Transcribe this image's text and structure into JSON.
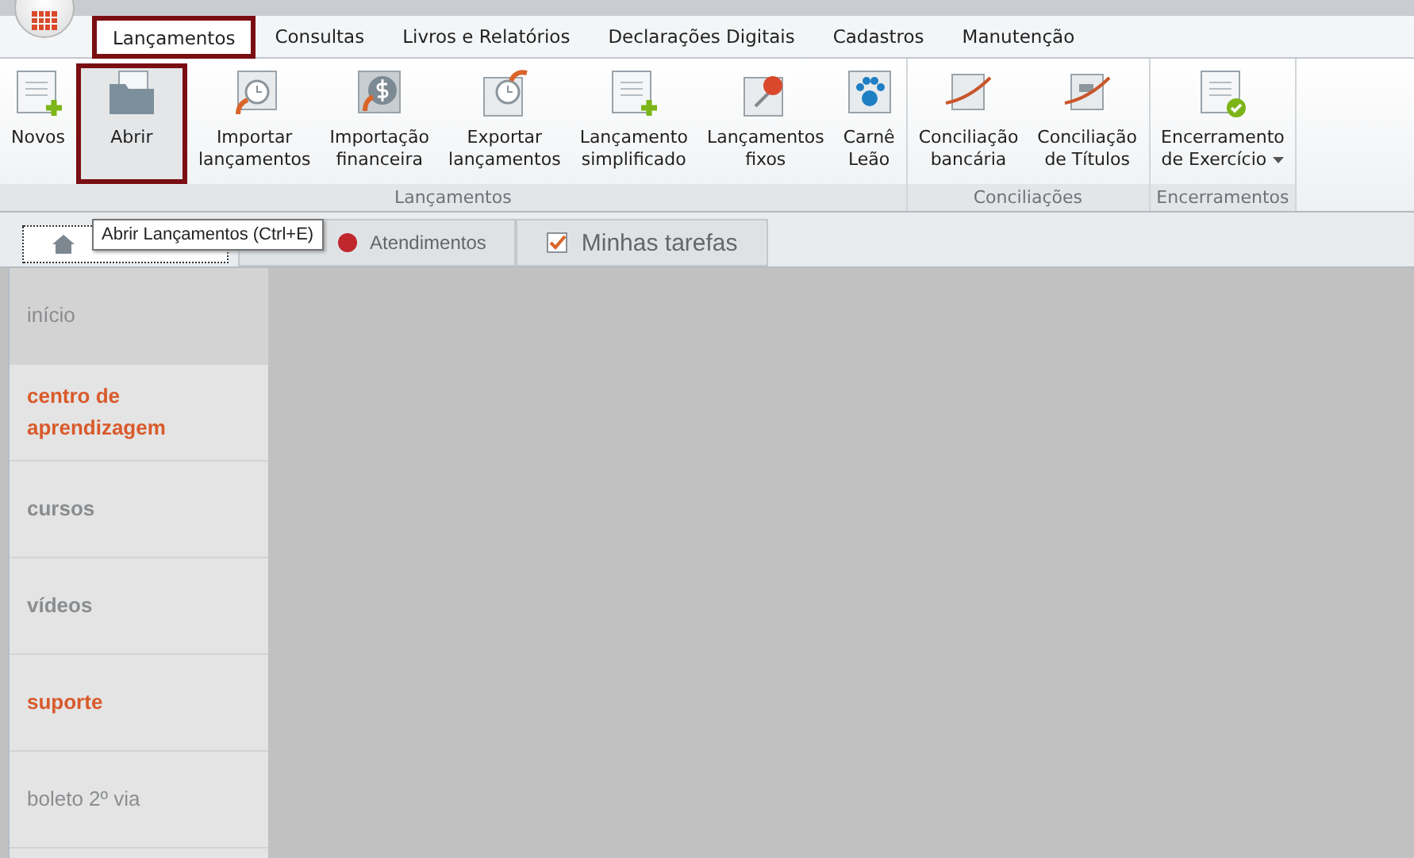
{
  "ribbon_tabs": [
    {
      "label": "Lançamentos",
      "selected": true,
      "highlighted": true
    },
    {
      "label": "Consultas",
      "selected": false,
      "highlighted": false
    },
    {
      "label": "Livros e Relatórios",
      "selected": false,
      "highlighted": false
    },
    {
      "label": "Declarações Digitais",
      "selected": false,
      "highlighted": false
    },
    {
      "label": "Cadastros",
      "selected": false,
      "highlighted": false
    },
    {
      "label": "Manutenção",
      "selected": false,
      "highlighted": false
    }
  ],
  "ribbon_groups": [
    {
      "label": "Lançamentos",
      "buttons": [
        {
          "label": "Novos",
          "highlighted": false
        },
        {
          "label": "Abrir",
          "highlighted": true
        },
        {
          "label": "Importar lançamentos",
          "highlighted": false
        },
        {
          "label": "Importação financeira",
          "highlighted": false
        },
        {
          "label": "Exportar lançamentos",
          "highlighted": false
        },
        {
          "label": "Lançamento simplificado",
          "highlighted": false
        },
        {
          "label": "Lançamentos fixos",
          "highlighted": false
        },
        {
          "label": "Carnê Leão",
          "highlighted": false
        }
      ]
    },
    {
      "label": "Conciliações",
      "buttons": [
        {
          "label": "Conciliação bancária",
          "highlighted": false
        },
        {
          "label": "Conciliação de Títulos",
          "highlighted": false
        }
      ]
    },
    {
      "label": "Encerramentos",
      "buttons": [
        {
          "label": "Encerramento de Exercício",
          "highlighted": false,
          "dropdown": true
        }
      ]
    }
  ],
  "tooltip": "Abrir Lançamentos (Ctrl+E)",
  "doc_tabs": [
    {
      "selected": true
    },
    {
      "label": "Atendimentos",
      "selected": false
    },
    {
      "label": "Minhas tarefas",
      "selected": false
    }
  ],
  "sidebar": {
    "items": [
      {
        "label": "início",
        "kind": "plain",
        "selected": true
      },
      {
        "label": "centro de aprendizagem",
        "kind": "accent",
        "selected": false
      },
      {
        "label": "cursos",
        "kind": "strong",
        "selected": false
      },
      {
        "label": "vídeos",
        "kind": "strong",
        "selected": false
      },
      {
        "label": "suporte",
        "kind": "accent",
        "selected": false
      },
      {
        "label": "boleto 2º via",
        "kind": "plain",
        "selected": false
      }
    ]
  }
}
